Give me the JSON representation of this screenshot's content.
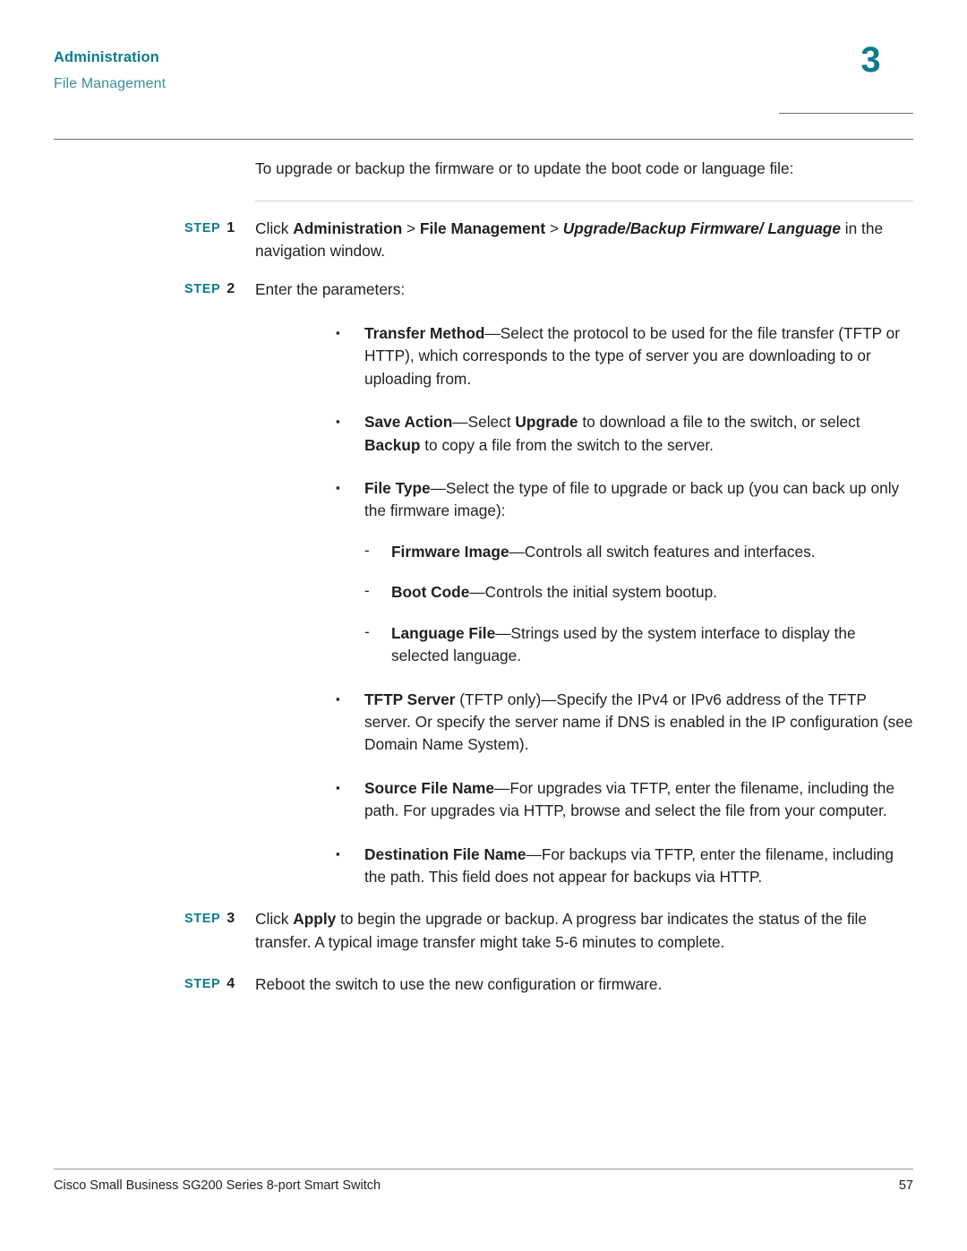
{
  "header": {
    "title": "Administration",
    "subtitle": "File Management",
    "chapter": "3"
  },
  "body": {
    "intro": "To upgrade or backup the firmware or to update the boot code or language file:",
    "step1": {
      "label": "STEP",
      "num": "1",
      "text_a": "Click ",
      "text_b": "Administration",
      "text_c": " > ",
      "text_d": "File Management",
      "text_e": " > ",
      "text_f": "Upgrade/Backup Firmware/ Language",
      "text_g": " in the navigation window."
    },
    "step2": {
      "label": "STEP",
      "num": "2",
      "text": "Enter the parameters:"
    },
    "bullets": [
      {
        "mark": "▪",
        "term": "Transfer Method",
        "text": "—Select the protocol to be used for the file transfer (TFTP or HTTP), which corresponds to the type of server you are downloading to or uploading from."
      },
      {
        "mark": "▪",
        "term": "Save Action",
        "text_1": "—Select ",
        "bold_1": "Upgrade",
        "text_2": " to download a file to the switch, or select ",
        "bold_2": "Backup",
        "text_3": " to copy a file from the switch to the server."
      },
      {
        "mark": "▪",
        "term": "File Type",
        "text": "—Select the type of file to upgrade or back up (you can back up only the firmware image):",
        "subbullets": [
          {
            "mark": "-",
            "term": "Firmware Image",
            "text": "—Controls all switch features and interfaces."
          },
          {
            "mark": "-",
            "term": "Boot Code",
            "text": "—Controls the initial system bootup."
          },
          {
            "mark": "-",
            "term": "Language File",
            "text": "—Strings used by the system interface to display the selected language."
          }
        ]
      },
      {
        "mark": "▪",
        "term": "TFTP Server",
        "text": " (TFTP only)—Specify the IPv4 or IPv6 address of the TFTP server. Or specify the server name if DNS is enabled in the IP configuration (see Domain Name System)."
      },
      {
        "mark": "▪",
        "term": "Source File Name",
        "text": "—For upgrades via TFTP, enter the filename, including the path. For upgrades via HTTP, browse and select the file from your computer."
      },
      {
        "mark": "▪",
        "term": "Destination File Name",
        "text": "—For backups via TFTP, enter the filename, including the path. This field does not appear for backups via HTTP."
      }
    ],
    "step3": {
      "label": "STEP",
      "num": "3",
      "text_a": "Click ",
      "text_b": "Apply",
      "text_c": " to begin the upgrade or backup. A progress bar indicates the status of the file transfer. A typical image transfer might take 5-6 minutes to complete."
    },
    "step4": {
      "label": "STEP",
      "num": "4",
      "text": "Reboot the switch to use the new configuration or firmware."
    }
  },
  "footer": {
    "left": "Cisco Small Business SG200 Series 8-port Smart Switch",
    "page": "57"
  }
}
